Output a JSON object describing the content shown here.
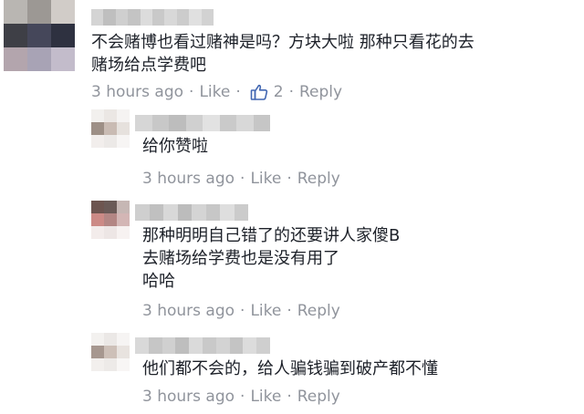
{
  "colors": {
    "meta_text": "#90949c",
    "comment_text": "#1d2129",
    "like_accent": "#4267b2"
  },
  "comments": [
    {
      "level": 0,
      "lines": [
        "不会赌博也看过赌神是吗？方块大啦 那种只看花的去",
        "赌场给点学费吧"
      ],
      "time": "3 hours ago",
      "like_label": "Like",
      "like_count": "2",
      "reply_label": "Reply",
      "avatar_colors": [
        "#b9b6b2",
        "#9c9894",
        "#d1ccc8",
        "#3e3f46",
        "#45475a",
        "#2e3140",
        "#b3a5ad",
        "#a8a3b5",
        "#c3bccb"
      ],
      "name_colors": [
        "#d4d4d4",
        "#bfbfbf",
        "#cfcfcf",
        "#c4c4c4",
        "#dcdcdc",
        "#c9c9c9",
        "#d8d8d8",
        "#cccccc",
        "#e0e0e0",
        "#d2d2d2"
      ]
    },
    {
      "level": 1,
      "lines": [
        "给你赞啦"
      ],
      "time": "3 hours ago",
      "like_label": "Like",
      "reply_label": "Reply",
      "avatar_colors": [
        "#f2f0ee",
        "#ebe7e4",
        "#f5f3f2",
        "#9d8f86",
        "#c9bbb3",
        "#e6e1dd",
        "#f2eeec",
        "#ece9e7",
        "#f7f5f4"
      ],
      "name_colors": [
        "#d6d6d6",
        "#c8c8c8",
        "#bdbdbd",
        "#d0d0d0",
        "#e2e2e2",
        "#cacaca",
        "#d8d8d8",
        "#c6c6c6"
      ]
    },
    {
      "level": 1,
      "lines": [
        "那种明明自己错了的还要讲人家傻B",
        "去赌场给学费也是没有用了",
        "哈哈"
      ],
      "time": "3 hours ago",
      "like_label": "Like",
      "reply_label": "Reply",
      "avatar_colors": [
        "#6d5550",
        "#6a5a57",
        "#c6b7b4",
        "#cc8a86",
        "#b38684",
        "#d3b6b5",
        "#f3eceb",
        "#ede6e5",
        "#f7f2f1"
      ],
      "name_colors": [
        "#cfcfcf",
        "#c0c0c0",
        "#d8d8d8",
        "#bcbcbc",
        "#d4d4d4",
        "#c7c7c7",
        "#dedede",
        "#cbcbcb"
      ]
    },
    {
      "level": 1,
      "lines": [
        "他们都不会的，给人骗钱骗到破产都不懂"
      ],
      "time": "3 hours ago",
      "like_label": "Like",
      "reply_label": "Reply",
      "avatar_colors": [
        "#f3f1ef",
        "#ebe8e6",
        "#f6f4f3",
        "#a6978f",
        "#cdc0b8",
        "#e8e3df",
        "#f2efed",
        "#edeae8",
        "#f8f6f5"
      ],
      "name_colors": [
        "#d9d9d9",
        "#c6c6c6",
        "#d0d0d0",
        "#bebebe",
        "#dadada",
        "#c9c9c9",
        "#d3d3d3",
        "#c4c4c4",
        "#dcdcdc",
        "#cfcfcf"
      ]
    }
  ]
}
